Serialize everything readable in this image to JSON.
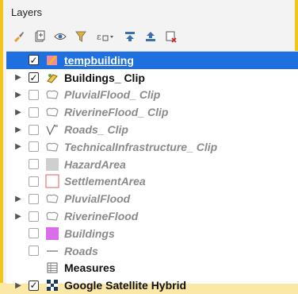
{
  "panel": {
    "title": "Layers"
  },
  "toolbar": {
    "icons": [
      "style-brush-icon",
      "add-group-icon",
      "visibility-eye-icon",
      "filter-icon",
      "expression-filter-icon",
      "expand-all-icon",
      "collapse-all-icon",
      "remove-layer-icon"
    ]
  },
  "layers": [
    {
      "label": "tempbuilding",
      "expander": false,
      "checked": true,
      "style": "selected",
      "symbol": "polygon-edit-icon"
    },
    {
      "label": "Buildings_ Clip",
      "expander": true,
      "checked": true,
      "style": "bold",
      "symbol": "multi-style-icon"
    },
    {
      "label": "PluvialFlood_ Clip",
      "expander": true,
      "checked": false,
      "style": "dim",
      "symbol": "polygon-outline-icon"
    },
    {
      "label": "RiverineFlood_ Clip",
      "expander": true,
      "checked": false,
      "style": "dim",
      "symbol": "polygon-outline-icon"
    },
    {
      "label": "Roads_ Clip",
      "expander": true,
      "checked": false,
      "style": "dim",
      "symbol": "line-symbol-icon"
    },
    {
      "label": "TechnicalInfrastructure_ Clip",
      "expander": true,
      "checked": false,
      "style": "dim",
      "symbol": "polygon-outline-icon"
    },
    {
      "label": "HazardArea",
      "expander": false,
      "checked": false,
      "style": "dim",
      "symbol": "gray-fill-icon"
    },
    {
      "label": "SettlementArea",
      "expander": false,
      "checked": false,
      "style": "dim",
      "symbol": "red-outline-icon"
    },
    {
      "label": "PluvialFlood",
      "expander": true,
      "checked": false,
      "style": "dim",
      "symbol": "polygon-outline-icon"
    },
    {
      "label": "RiverineFlood",
      "expander": true,
      "checked": false,
      "style": "dim",
      "symbol": "polygon-outline-icon"
    },
    {
      "label": "Buildings",
      "expander": false,
      "checked": false,
      "style": "dim",
      "symbol": "purple-fill-icon"
    },
    {
      "label": "Roads",
      "expander": false,
      "checked": false,
      "style": "dim",
      "symbol": "line-dash-icon"
    },
    {
      "label": "Measures",
      "expander": false,
      "checked": null,
      "style": "bold",
      "symbol": "table-icon"
    },
    {
      "label": "Google Satellite Hybrid",
      "expander": true,
      "checked": true,
      "style": "bold",
      "symbol": "raster-icon"
    }
  ],
  "colors": {
    "selected": "#1e6fe0",
    "frame": "#f0c419",
    "purple_fill": "#d96ee8",
    "red_outline": "#e85a5a"
  }
}
